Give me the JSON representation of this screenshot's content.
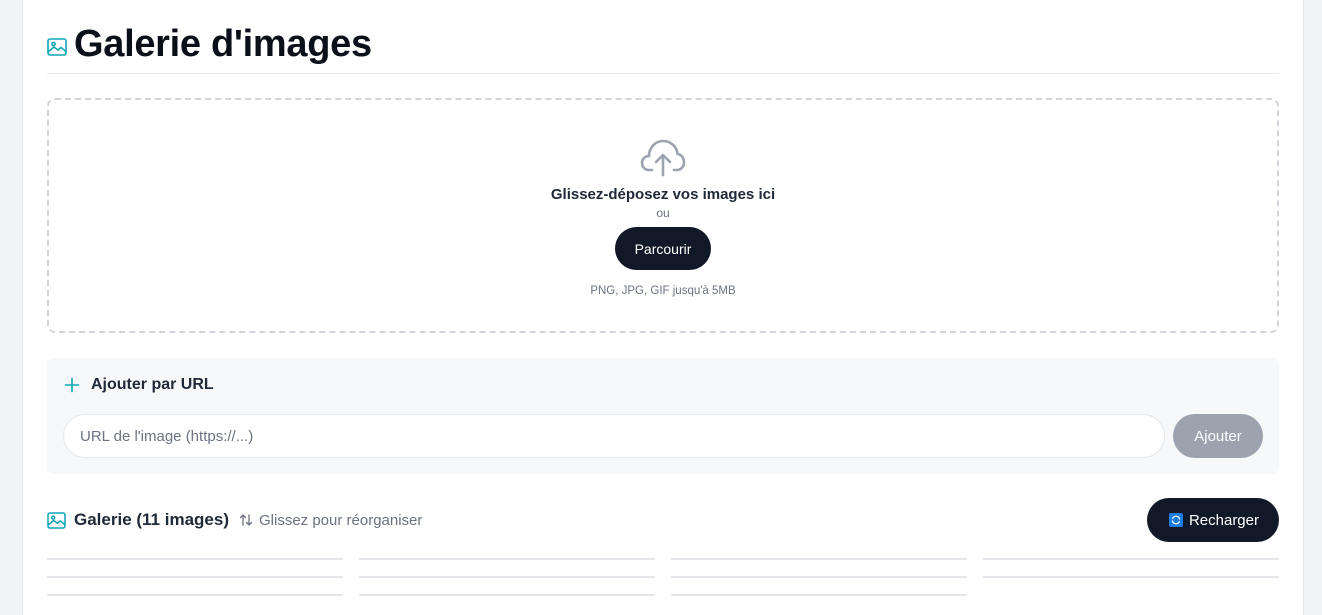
{
  "header": {
    "title": "Galerie d'images",
    "icon": "image-icon"
  },
  "dropzone": {
    "icon": "cloud-upload-icon",
    "title": "Glissez-déposez vos images ici",
    "or_text": "ou",
    "browse_label": "Parcourir",
    "hint": "PNG, JPG, GIF jusqu'à 5MB"
  },
  "url_section": {
    "icon": "plus-icon",
    "title": "Ajouter par URL",
    "input_value": "",
    "input_placeholder": "URL de l'image (https://...)",
    "add_label": "Ajouter"
  },
  "gallery": {
    "icon": "image-icon",
    "title": "Galerie (11 images)",
    "sort_icon": "reorder-arrows-icon",
    "hint": "Glissez pour réorganiser",
    "reload_icon": "refresh-icon",
    "reload_label": "Recharger"
  },
  "colors": {
    "accent": "#0ea5b7",
    "dark_button": "#111827",
    "disabled_button": "#9ca3af",
    "border": "#e5e7eb"
  }
}
